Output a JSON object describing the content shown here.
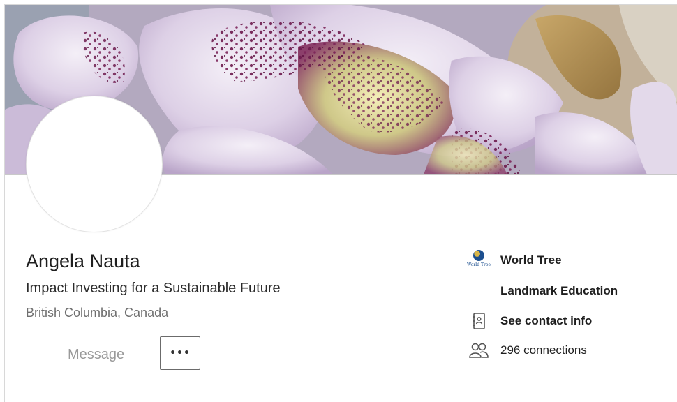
{
  "profile": {
    "name": "Angela Nauta",
    "headline": "Impact Investing for a Sustainable Future",
    "location": "British Columbia, Canada"
  },
  "actions": {
    "message_label": "Message",
    "more_label": "•••"
  },
  "sidebar": {
    "company_logo_text": "World Tree",
    "company": "World Tree",
    "education": "Landmark Education",
    "contact_info": "See contact info",
    "connections": "296 connections"
  },
  "banner": {
    "subject": "purple and white flower close-up",
    "icon": "banner-image"
  },
  "icons": {
    "company": "world-tree-logo-icon",
    "contact": "contact-card-icon",
    "connections": "people-icon"
  },
  "colors": {
    "name": "#1f1f1f",
    "location": "#6f6f6f",
    "message": "#9a9a9a"
  }
}
